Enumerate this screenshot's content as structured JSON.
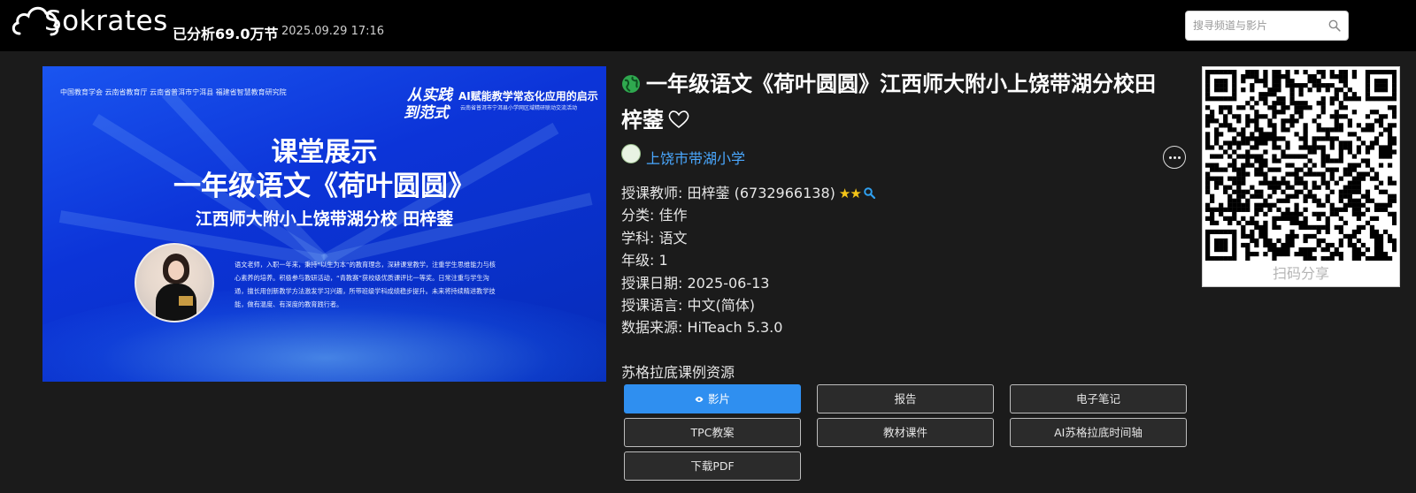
{
  "header": {
    "logo_text": "Sokrates",
    "analyzed": "已分析69.0万节",
    "datetime": "2025.09.29 17:16",
    "search_placeholder": "搜寻频道与影片"
  },
  "thumbnail": {
    "logos_text": "中国教育学会  云南省教育厅  云南省普洱市宁洱县  福建省智慧教育研究院",
    "brand_line1": "从实践",
    "brand_line2": "到范式",
    "brand_headline": "AI赋能教学常态化应用的启示",
    "brand_sub": "云南省普洱市宁洱县小学网区域精研联动交流活动",
    "heading1": "课堂展示",
    "heading2": "一年级语文《荷叶圆圆》",
    "heading3": "江西师大附小上饶带湖分校  田梓蓥",
    "bio": "语文老师，入职一年来，秉持“以生为本”的教育理念，深耕课堂教学，注重学生思维能力与核心素养的培养。积极参与教研活动，“青教赛”获校级优质课评比一等奖。日常注重与学生沟通，擅长用创新教学方法激发学习兴趣，所带班级学科成绩稳步提升。未来将持续精进教学技能，做有温度、有深度的教育践行者。"
  },
  "lesson": {
    "title": "一年级语文《荷叶圆圆》江西师大附小上饶带湖分校田梓蓥",
    "school_name": "上饶市带湖小学",
    "teacher_label": "授课教师:",
    "teacher_value": "田梓蓥 (6732966138)",
    "stars": "★★",
    "category_label": "分类:",
    "category_value": "佳作",
    "subject_label": "学科:",
    "subject_value": "语文",
    "grade_label": "年级:",
    "grade_value": "1",
    "date_label": "授课日期:",
    "date_value": "2025-06-13",
    "language_label": "授课语言:",
    "language_value": "中文(简体)",
    "source_label": "数据来源:",
    "source_value": "HiTeach 5.3.0"
  },
  "resources": {
    "title": "苏格拉底课例资源",
    "buttons": [
      "影片",
      "报告",
      "电子笔记",
      "TPC教案",
      "教材课件",
      "AI苏格拉底时间轴",
      "下载PDF"
    ],
    "active_index": 0
  },
  "qr": {
    "label": "扫码分享"
  },
  "colors": {
    "accent": "#2f8ff0",
    "link": "#4aa8ff",
    "star": "#f5c518",
    "background": "#1b1b1b"
  },
  "icons": [
    "cloud-logo-icon",
    "search-icon",
    "globe-icon",
    "heart-icon",
    "more-icon",
    "magnifier-icon",
    "eye-icon",
    "qr-code-icon"
  ]
}
